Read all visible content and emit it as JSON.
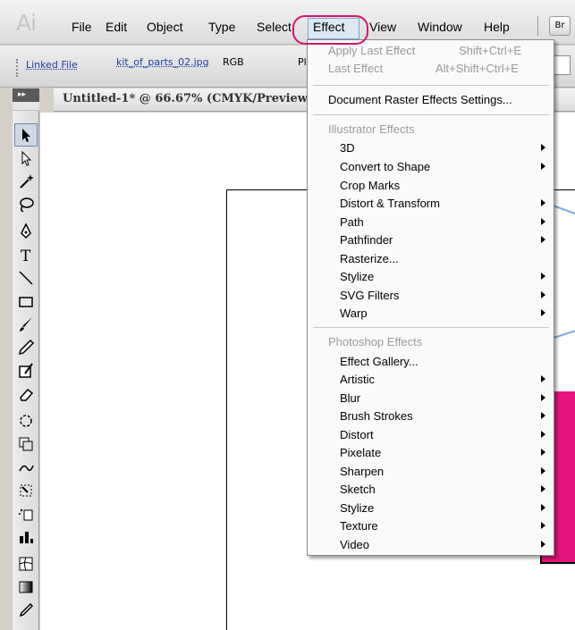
{
  "app": {
    "logo": "Ai"
  },
  "menubar": {
    "items": [
      "File",
      "Edit",
      "Object",
      "Type",
      "Select",
      "Effect",
      "View",
      "Window",
      "Help"
    ],
    "active": "Effect",
    "bridge_button": "Br"
  },
  "controlbar": {
    "linked_file": "Linked File",
    "filename": "kit_of_parts_02.jpg",
    "color_mode": "RGB",
    "truncated": "Pl"
  },
  "document": {
    "tab_title": "Untitled-1* @ 66.67% (CMYK/Preview)"
  },
  "tools": {
    "header": "▸▸",
    "items": [
      "selection-tool",
      "direct-selection-tool",
      "magic-wand-tool",
      "lasso-tool",
      "pen-tool",
      "type-tool",
      "line-segment-tool",
      "rectangle-tool",
      "paintbrush-tool",
      "pencil-tool",
      "blob-brush-tool",
      "eraser-tool",
      "rotate-tool",
      "scale-tool",
      "warp-tool",
      "free-transform-tool",
      "symbol-sprayer-tool",
      "column-graph-tool",
      "mesh-tool",
      "gradient-tool",
      "eyedropper-tool"
    ]
  },
  "effect_menu": {
    "apply_last": {
      "label": "Apply Last Effect",
      "shortcut": "Shift+Ctrl+E"
    },
    "last_effect": {
      "label": "Last Effect",
      "shortcut": "Alt+Shift+Ctrl+E"
    },
    "raster_settings": "Document Raster Effects Settings...",
    "illustrator_header": "Illustrator Effects",
    "illustrator_items": [
      "3D",
      "Convert to Shape",
      "Crop Marks",
      "Distort & Transform",
      "Path",
      "Pathfinder",
      "Rasterize...",
      "Stylize",
      "SVG Filters",
      "Warp"
    ],
    "illustrator_submenu": [
      true,
      true,
      false,
      true,
      true,
      true,
      false,
      true,
      true,
      true
    ],
    "photoshop_header": "Photoshop Effects",
    "photoshop_items": [
      "Effect Gallery...",
      "Artistic",
      "Blur",
      "Brush Strokes",
      "Distort",
      "Pixelate",
      "Sharpen",
      "Sketch",
      "Stylize",
      "Texture",
      "Video"
    ],
    "photoshop_submenu": [
      false,
      true,
      true,
      true,
      true,
      true,
      true,
      true,
      true,
      true,
      true
    ]
  },
  "colors": {
    "accent": "#d2136f",
    "artwork_pink": "#e4147d",
    "link_blue": "#1a3fa8",
    "guide_blue": "#7aa7e6"
  }
}
